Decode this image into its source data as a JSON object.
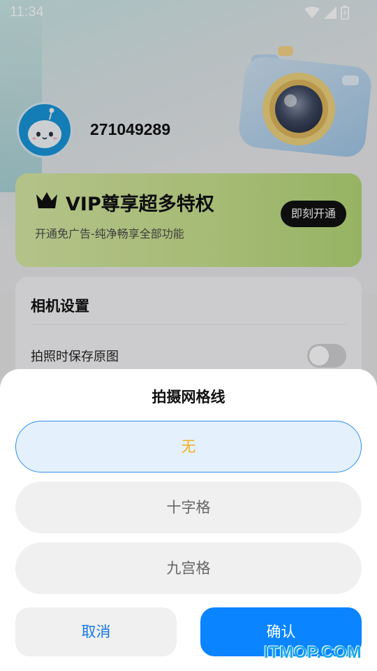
{
  "status_bar": {
    "time": "11:34",
    "icons": [
      "wifi-icon",
      "signal-icon",
      "battery-icon"
    ]
  },
  "profile": {
    "user_id": "271049289"
  },
  "vip": {
    "title": "VIP尊享超多特权",
    "subtitle": "开通免广告-纯净畅享全部功能",
    "button_label": "即刻开通"
  },
  "camera_settings": {
    "title": "相机设置",
    "rows": [
      {
        "label": "拍照时保存原图",
        "toggle_on": false
      }
    ]
  },
  "grid_sheet": {
    "title": "拍摄网格线",
    "options": [
      {
        "label": "无",
        "selected": true
      },
      {
        "label": "十字格",
        "selected": false
      },
      {
        "label": "九宫格",
        "selected": false
      }
    ],
    "cancel_label": "取消",
    "confirm_label": "确认"
  },
  "watermark": "ITMOP.COM",
  "colors": {
    "accent_blue": "#0a84ff",
    "selected_text": "#f2b01c",
    "vip_green": "#c7e08d"
  }
}
